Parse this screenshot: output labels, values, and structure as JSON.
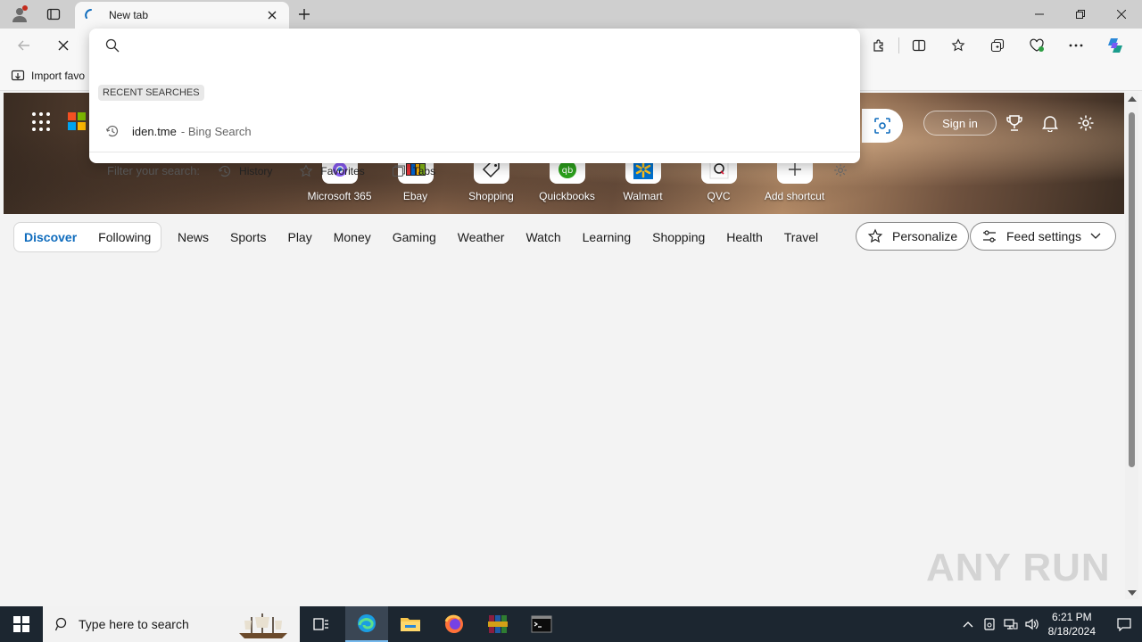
{
  "browser": {
    "tab_title": "New tab",
    "favorites_bar_item": "Import favo",
    "address_placeholder": ""
  },
  "hero": {
    "signin_label": "Sign in",
    "shortcuts": [
      {
        "label": "Microsoft 365",
        "icon": "microsoft365-icon"
      },
      {
        "label": "Ebay",
        "icon": "ebay-icon"
      },
      {
        "label": "Shopping",
        "icon": "shopping-tag-icon"
      },
      {
        "label": "Quickbooks",
        "icon": "quickbooks-icon"
      },
      {
        "label": "Walmart",
        "icon": "walmart-icon"
      },
      {
        "label": "QVC",
        "icon": "qvc-icon"
      },
      {
        "label": "Add shortcut",
        "icon": "plus-icon"
      }
    ]
  },
  "feed": {
    "tabs": [
      "Discover",
      "Following"
    ],
    "categories": [
      "News",
      "Sports",
      "Play",
      "Money",
      "Gaming",
      "Weather",
      "Watch",
      "Learning",
      "Shopping",
      "Health",
      "Travel"
    ],
    "personalize_label": "Personalize",
    "feed_settings_label": "Feed settings"
  },
  "dropdown": {
    "recent_header": "RECENT SEARCHES",
    "history_query": "iden.tme",
    "history_source": "- Bing Search",
    "filter_label": "Filter your search:",
    "filter_options": [
      "History",
      "Favorites",
      "Tabs"
    ]
  },
  "taskbar": {
    "search_placeholder": "Type here to search",
    "time": "6:21 PM",
    "date": "8/18/2024"
  },
  "watermark": "ANY RUN",
  "colors": {
    "accent": "#0f6cbd",
    "taskbar": "#1c2630",
    "tabstrip": "#cfcfcf"
  }
}
